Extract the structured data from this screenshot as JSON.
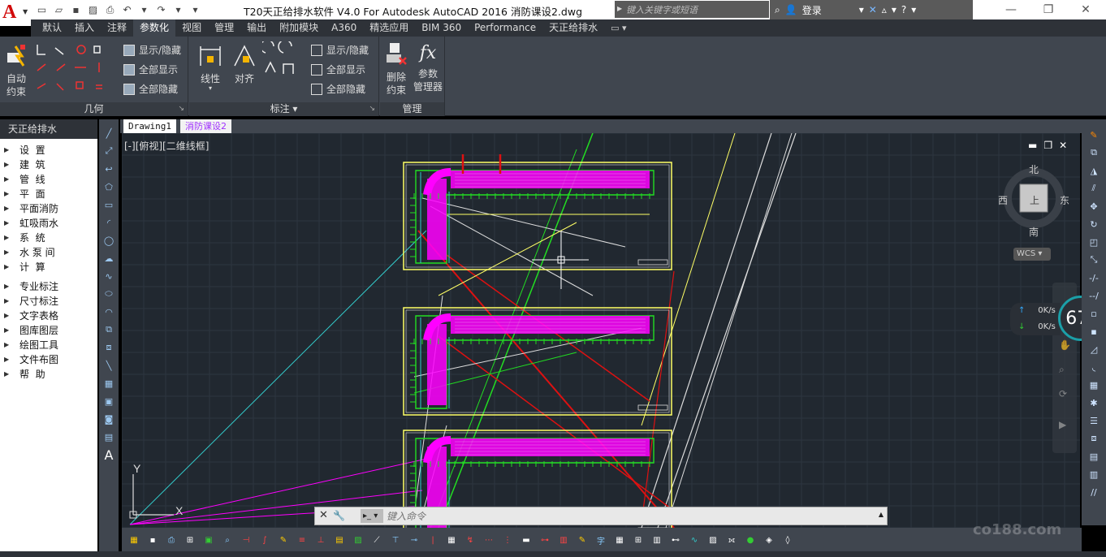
{
  "app": {
    "logo": "A",
    "title": "T20天正给排水软件 V4.0 For Autodesk AutoCAD 2016    消防课设2.dwg"
  },
  "search": {
    "placeholder": "键入关键字或短语"
  },
  "account": {
    "login": "登录"
  },
  "ribbon_tabs": [
    "默认",
    "插入",
    "注释",
    "参数化",
    "视图",
    "管理",
    "输出",
    "附加模块",
    "A360",
    "精选应用",
    "BIM 360",
    "Performance",
    "天正给排水"
  ],
  "active_tab": "参数化",
  "panels": {
    "geometry": {
      "title": "几何",
      "auto_label": "自动\n约束",
      "show_hide": "显示/隐藏",
      "show_all": "全部显示",
      "hide_all": "全部隐藏"
    },
    "annotate": {
      "title": "标注",
      "linear": "线性",
      "aligned": "对齐",
      "show_hide": "显示/隐藏",
      "show_all": "全部显示",
      "hide_all": "全部隐藏"
    },
    "manage": {
      "title": "管理",
      "delete": "删除\n约束",
      "param": "参数\n管理器",
      "fx": "fx"
    }
  },
  "palette": {
    "title": "天正给排水",
    "items": [
      "设  置",
      "建  筑",
      "管  线",
      "平  面",
      "平面消防",
      "虹吸雨水",
      "系  统",
      "水 泵 间",
      "计  算"
    ],
    "items2": [
      "专业标注",
      "尺寸标注",
      "文字表格",
      "图库图层",
      "绘图工具",
      "文件布图",
      "帮  助"
    ]
  },
  "doc_tabs": [
    "Drawing1",
    "消防课设2"
  ],
  "viewport": {
    "label": "[-][俯视][二维线框]"
  },
  "viewcube": {
    "north": "北",
    "south": "南",
    "east": "东",
    "west": "西",
    "top": "上",
    "wcs": "WCS"
  },
  "ucs": {
    "x": "X",
    "y": "Y"
  },
  "command": {
    "placeholder": "键入命令"
  },
  "network": {
    "up": "0K/s",
    "down": "0K/s",
    "percent": "67",
    "unit": "%"
  },
  "watermark": "co188.com",
  "colors": {
    "magenta": "#ff00ff",
    "yellow": "#ffff66",
    "green": "#22dd22",
    "red": "#dd1111",
    "cyan": "#33cccc",
    "white": "#dddddd",
    "grid": "#2d3640"
  }
}
